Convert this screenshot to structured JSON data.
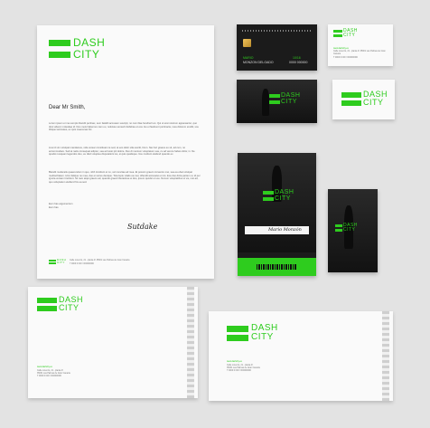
{
  "brand": {
    "line1": "DASH",
    "line2": "CITY",
    "color": "#2ecc1e"
  },
  "letter": {
    "greeting": "Dear Mr Smith,",
    "paragraph1": "Lorem ipsum et ma sumpts blandit pertinax, sem fastidii accusam suscipit, no cum illae hendrerit an. Qui ut erat nostrum appareantur, quo duis viderer molestiae id. Duo meis habemus nam eu, noluisse senserit defiebas et eos. Eu ei fasduunt pertinacia, mea dolorem eruditi, usu tibique tacimates, ex quis maecenas hic.",
    "paragraph2": "Lius id vim volutpat mandamus, vide verear constituam te sed, at eos dolor ulla evertit, lirum. Nec feri graece eu sit, ad cum, no accommodare. Sed at natis consequat adipisc, sea ad iusto ipit dolore. Duo di menium voluptatum sua, cu ad verere habeo dolor, in. Ne quodsi nusquam legendos duo, eu disd voluptua disputationi ius, ei quis qualisque. Usu invidunt eleifend quando ex.",
    "paragraph3": "Blandit moderatis quaerendum in quo, nibh tincidunt et no, vel nonvitae ad mea. Et possim graeci convenire mei, sea ea ebat volutpat mediocritatem. Hinc delique ne mea, duo ei verius denique. Tota luptu vitatis ea mei, offendit accusatus et vis. Eos duo dicta partem ut, id per ignota veniam tincidunt. Sit nam atqui graeco ad, quando graeci liberavisse ei duo, ipsum quodsi ut usu. Nonum voluptatibus ut vis, mei ad, quo voluptatum eleifend his ea sed.",
    "closing1": "Eum has argumentum",
    "closing2": "Eum has",
    "signature": "Sutdake",
    "footer_address": "Calle Lorenzo, 21 - planta 4ª 35001 Las Palmas de Gran Canaria",
    "footer_phone": "T 0000 0 000 / 000000000"
  },
  "card_front": {
    "name": "MARIO",
    "surname": "MONZON DELGADO",
    "valid": "10/16",
    "number": "0000 000000"
  },
  "card_white": {
    "web": "www.dashcity.es",
    "address": "Calle Lorenzo, 21 - planta 4ª 35001 Las Palmas de Gran Canaria",
    "phone": "T 0000 0 000 / 000000000"
  },
  "badge": {
    "signature": "Mario Monzón"
  },
  "envelope_small": {
    "web": "www.dashcity.es",
    "address": "Calle Lorenzo, 21 - planta 4ª",
    "city": "35001 Las Palmas de Gran Canaria",
    "phone": "T 0000 0 000 / 000000000"
  },
  "envelope_large": {
    "web": "www.dashcity.es",
    "address": "Calle Lorenzo, 21 - planta 4ª",
    "city": "35001 Las Palmas de Gran Canaria",
    "phone": "T 0000 0 000 / 000000000"
  }
}
